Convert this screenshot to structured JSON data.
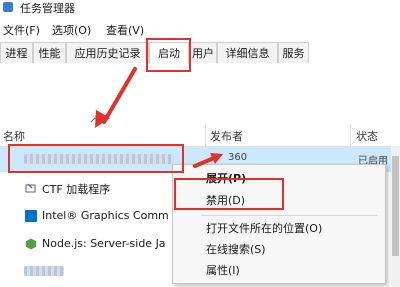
{
  "window": {
    "title": "任务管理器"
  },
  "menu": [
    "文件(F)",
    "选项(O)",
    "查看(V)"
  ],
  "tabs": [
    "进程",
    "性能",
    "应用历史记录",
    "启动",
    "用户",
    "详细信息",
    "服务"
  ],
  "active_tab": "启动",
  "columns": {
    "name": "名称",
    "publisher": "发布者",
    "status": "状态"
  },
  "rows": [
    {
      "name": "",
      "publisher": "",
      "status": "",
      "icon": "blurred-app-icon"
    },
    {
      "name": "CTF 加载程序",
      "publisher": "",
      "status": "",
      "icon": "ctf-loader-icon"
    },
    {
      "name": "Intel® Graphics Comm",
      "publisher": "",
      "status": "",
      "icon": "intel-graphics-icon"
    },
    {
      "name": "Node.js: Server-side Ja",
      "publisher": "",
      "status": "",
      "icon": "nodejs-icon"
    },
    {
      "name": "",
      "publisher": "",
      "status": "",
      "icon": "blurred-app-icon"
    }
  ],
  "context_menu": {
    "items": [
      "展开(P)",
      "禁用(D)",
      "打开文件所在的位置(O)",
      "在线搜索(S)",
      "属性(I)"
    ]
  },
  "partial_texts": {
    "publisher_peek": "360",
    "status_peek": "已启用"
  },
  "colors": {
    "highlight_red": "#e0312b",
    "selected_row": "#cce8ff"
  }
}
